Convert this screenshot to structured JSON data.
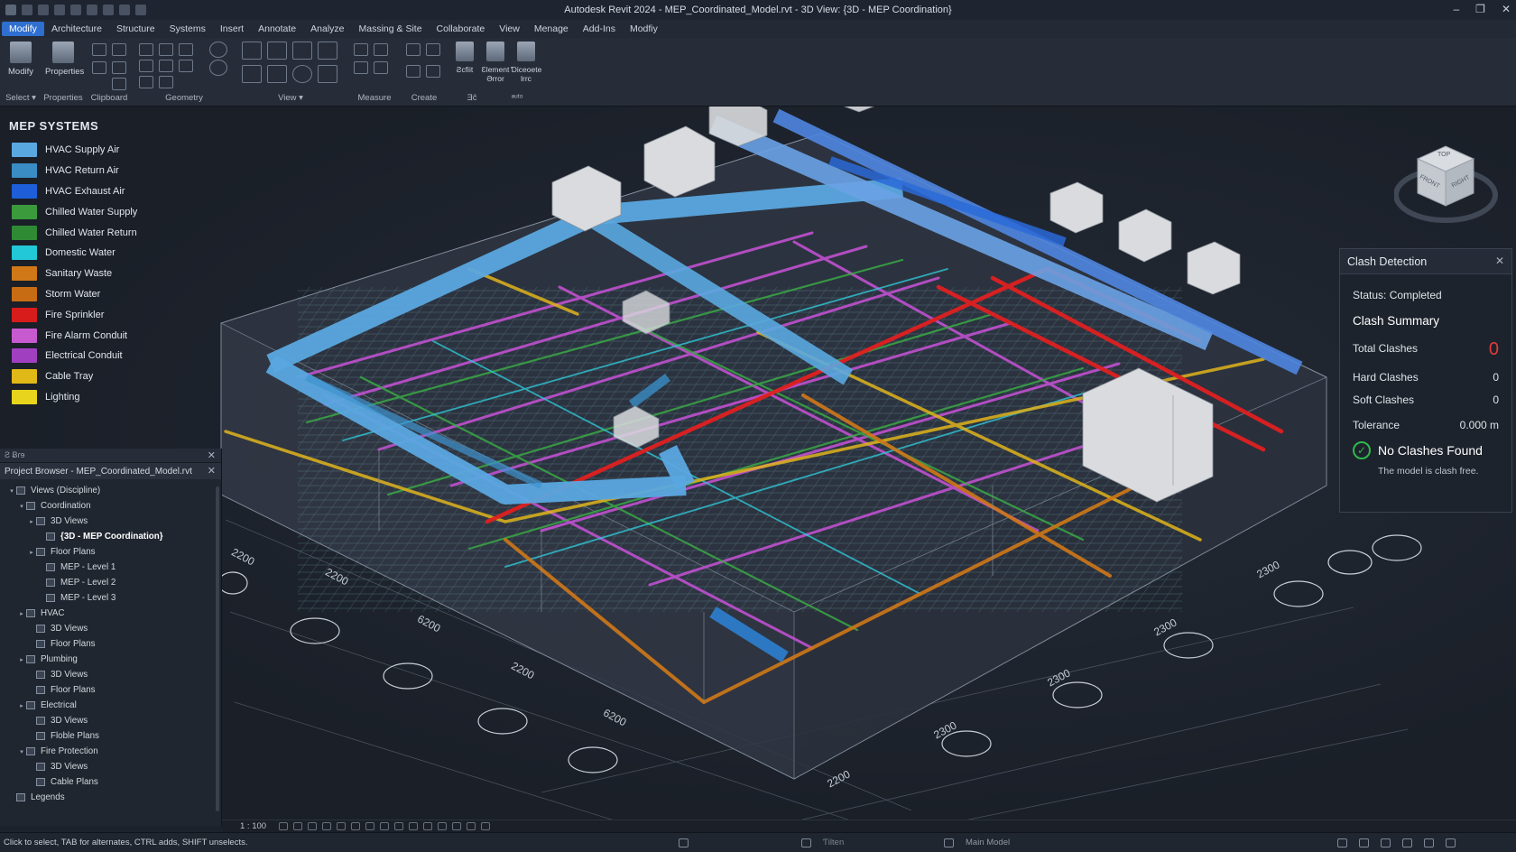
{
  "window": {
    "title": "Autodesk Revit 2024 - MEP_Coordinated_Model.rvt - 3D View: {3D - MEP Coordination}",
    "controls": [
      "–",
      "❐",
      "✕"
    ]
  },
  "menu": {
    "tabs": [
      "Modify",
      "Architecture",
      "Structure",
      "Systems",
      "Insert",
      "Annotate",
      "Analyze",
      "Massing & Site",
      "Collaborate",
      "View",
      "Menage",
      "Add-Ins",
      "Modfiy"
    ],
    "active": "Modify"
  },
  "ribbon": {
    "modify_label": "Modify",
    "properties_label": "Properties",
    "groups": {
      "select": "Select ▾",
      "properties": "Properties",
      "clipboard": "Clipboard",
      "geometry": "Geometry",
      "view": "View ▾",
      "measure": "Measure",
      "create": "Create",
      "misc1": "Ǝĉ",
      "misc2": "ᵃᵘᵗᵒ"
    },
    "small_buttons": [
      "Ƨcfiit",
      "Ɛlement Ərror",
      "Ɗiceoete lrrc"
    ]
  },
  "legend": {
    "title": "MEP SYSTEMS",
    "items": [
      {
        "label": "HVAC Supply Air",
        "color": "#5aa8e0"
      },
      {
        "label": "HVAC Return Air",
        "color": "#3a8cc4"
      },
      {
        "label": "HVAC Exhaust Air",
        "color": "#1e5ed8"
      },
      {
        "label": "Chilled Water Supply",
        "color": "#3a9a3c"
      },
      {
        "label": "Chilled Water Return",
        "color": "#2f8a34"
      },
      {
        "label": "Domestic Water",
        "color": "#22c8d8"
      },
      {
        "label": "Sanitary Waste",
        "color": "#d07818"
      },
      {
        "label": "Storm Water",
        "color": "#c86c14"
      },
      {
        "label": "Fire Sprinkler",
        "color": "#d81c1c"
      },
      {
        "label": "Fire Alarm Conduit",
        "color": "#c85ad0"
      },
      {
        "label": "Electrical Conduit",
        "color": "#a040c0"
      },
      {
        "label": "Cable Tray",
        "color": "#e0b818"
      },
      {
        "label": "Lighting",
        "color": "#e8d41c"
      }
    ]
  },
  "project_browser": {
    "strip_label": "Ƨ Ƀɾɘ",
    "header": "Project Browser - MEP_Coordinated_Model.rvt",
    "tree": [
      {
        "label": "Views (Discipline)",
        "level": 0,
        "toggle": "▾"
      },
      {
        "label": "Coordination",
        "level": 1,
        "toggle": "▾"
      },
      {
        "label": "3D Views",
        "level": 2,
        "toggle": "▸"
      },
      {
        "label": "{3D - MEP Coordination}",
        "level": 3,
        "toggle": "",
        "selected": true
      },
      {
        "label": "Floor Plans",
        "level": 2,
        "toggle": "▸"
      },
      {
        "label": "MEP - Level 1",
        "level": 3,
        "toggle": ""
      },
      {
        "label": "MEP - Level 2",
        "level": 3,
        "toggle": ""
      },
      {
        "label": "MEP - Level 3",
        "level": 3,
        "toggle": ""
      },
      {
        "label": "HVAC",
        "level": 1,
        "toggle": "▸"
      },
      {
        "label": "3D Views",
        "level": 2,
        "toggle": ""
      },
      {
        "label": "Floor Plans",
        "level": 2,
        "toggle": ""
      },
      {
        "label": "Plumbing",
        "level": 1,
        "toggle": "▸"
      },
      {
        "label": "3D Views",
        "level": 2,
        "toggle": ""
      },
      {
        "label": "Floor Plans",
        "level": 2,
        "toggle": ""
      },
      {
        "label": "Electrical",
        "level": 1,
        "toggle": "▸"
      },
      {
        "label": "3D Views",
        "level": 2,
        "toggle": ""
      },
      {
        "label": "Floble Plans",
        "level": 2,
        "toggle": ""
      },
      {
        "label": "Fire Protection",
        "level": 1,
        "toggle": "▾"
      },
      {
        "label": "3D Views",
        "level": 2,
        "toggle": ""
      },
      {
        "label": "Cable Plans",
        "level": 2,
        "toggle": ""
      },
      {
        "label": "Legends",
        "level": 0,
        "toggle": ""
      }
    ]
  },
  "viewcube": {
    "top": "TOP",
    "front": "FRONT",
    "right": "RIGHT"
  },
  "clash": {
    "title": "Clash Detection",
    "close": "✕",
    "status": "Status: Completed",
    "summary_title": "Clash Summary",
    "total_label": "Total Clashes",
    "total_value": "0",
    "hard_label": "Hard Clashes",
    "hard_value": "0",
    "soft_label": "Soft Clashes",
    "soft_value": "0",
    "tolerance_label": "Tolerance",
    "tolerance_value": "0.000 m",
    "result_title": "No Clashes Found",
    "result_sub": "The model is clash free."
  },
  "grid_labels": [
    "2200",
    "2200",
    "6200",
    "2200",
    "6200",
    "2300",
    "2300",
    "2300",
    "2300",
    "2200"
  ],
  "viewbar": {
    "scale": "1 : 100"
  },
  "status": {
    "hint": "Click to select, TAB for alternates, CTRL adds, SHIFT unselects.",
    "main_model": "Main Model",
    "filter": "Ƭilten"
  }
}
